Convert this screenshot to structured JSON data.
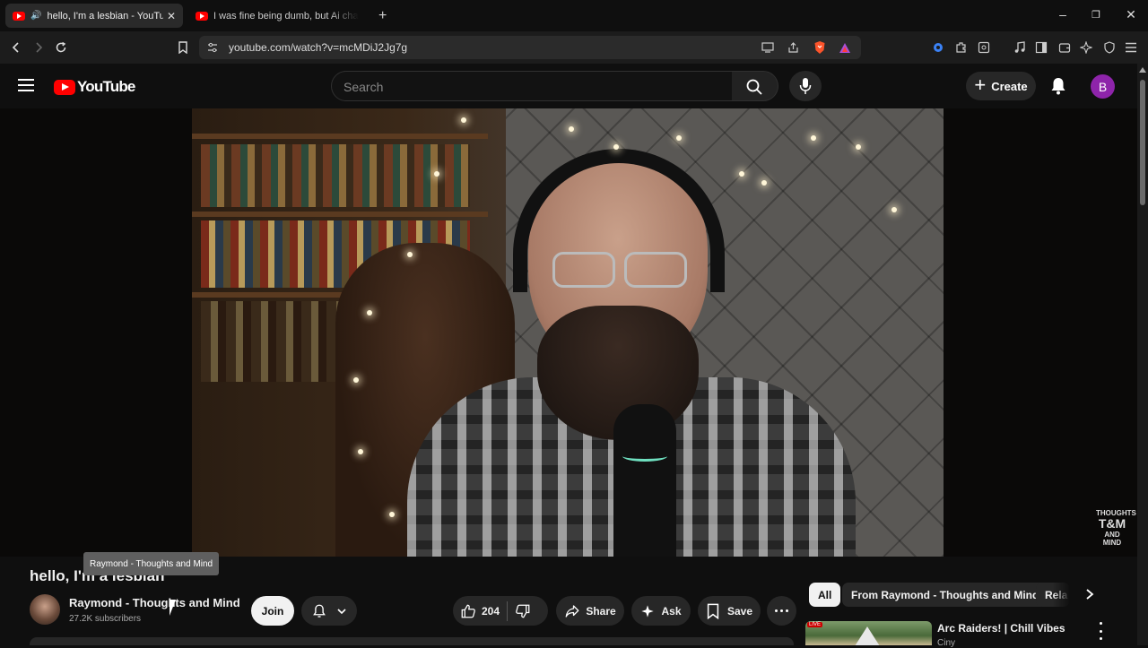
{
  "browser": {
    "tabs": [
      {
        "title": "hello, I'm a lesbian - YouTube",
        "active": true
      },
      {
        "title": "I was fine being dumb, but Ai change",
        "active": false
      }
    ],
    "url": "youtube.com/watch?v=mcMDiJ2Jg7g",
    "new_tab_glyph": "+",
    "icons": [
      "back-icon",
      "forward-icon",
      "reload-icon",
      "bookmark-icon",
      "site-settings-icon",
      "cast-icon",
      "share-icon",
      "brave-shield-icon",
      "rewards-icon",
      "extensions-icon",
      "music-icon",
      "sidebar-icon",
      "wallet-icon",
      "leo-icon",
      "vpn-icon",
      "menu-icon"
    ]
  },
  "youtube": {
    "logo_text": "YouTube",
    "search_placeholder": "Search",
    "create_label": "Create",
    "avatar_letter": "B",
    "brand_color": "#ff0000"
  },
  "video": {
    "title": "hello, I'm a lesbian",
    "watermark_line1": "THOUGHTS",
    "watermark_line2": "T&M",
    "watermark_line3": "AND MIND"
  },
  "channel": {
    "name": "Raymond - Thoughts and Mind",
    "subscribers": "27.2K subscribers",
    "tooltip": "Raymond - Thoughts and Mind",
    "join_label": "Join"
  },
  "actions": {
    "likes": "204",
    "share_label": "Share",
    "ask_label": "Ask",
    "save_label": "Save"
  },
  "chips": [
    {
      "label": "All",
      "active": true
    },
    {
      "label": "From Raymond - Thoughts and Mind",
      "active": false
    },
    {
      "label": "Rela",
      "active": false
    }
  ],
  "recommendation": {
    "title": "Arc Raiders! | Chill Vibes",
    "channel": "Ciny",
    "live_tag": "LIVE"
  }
}
